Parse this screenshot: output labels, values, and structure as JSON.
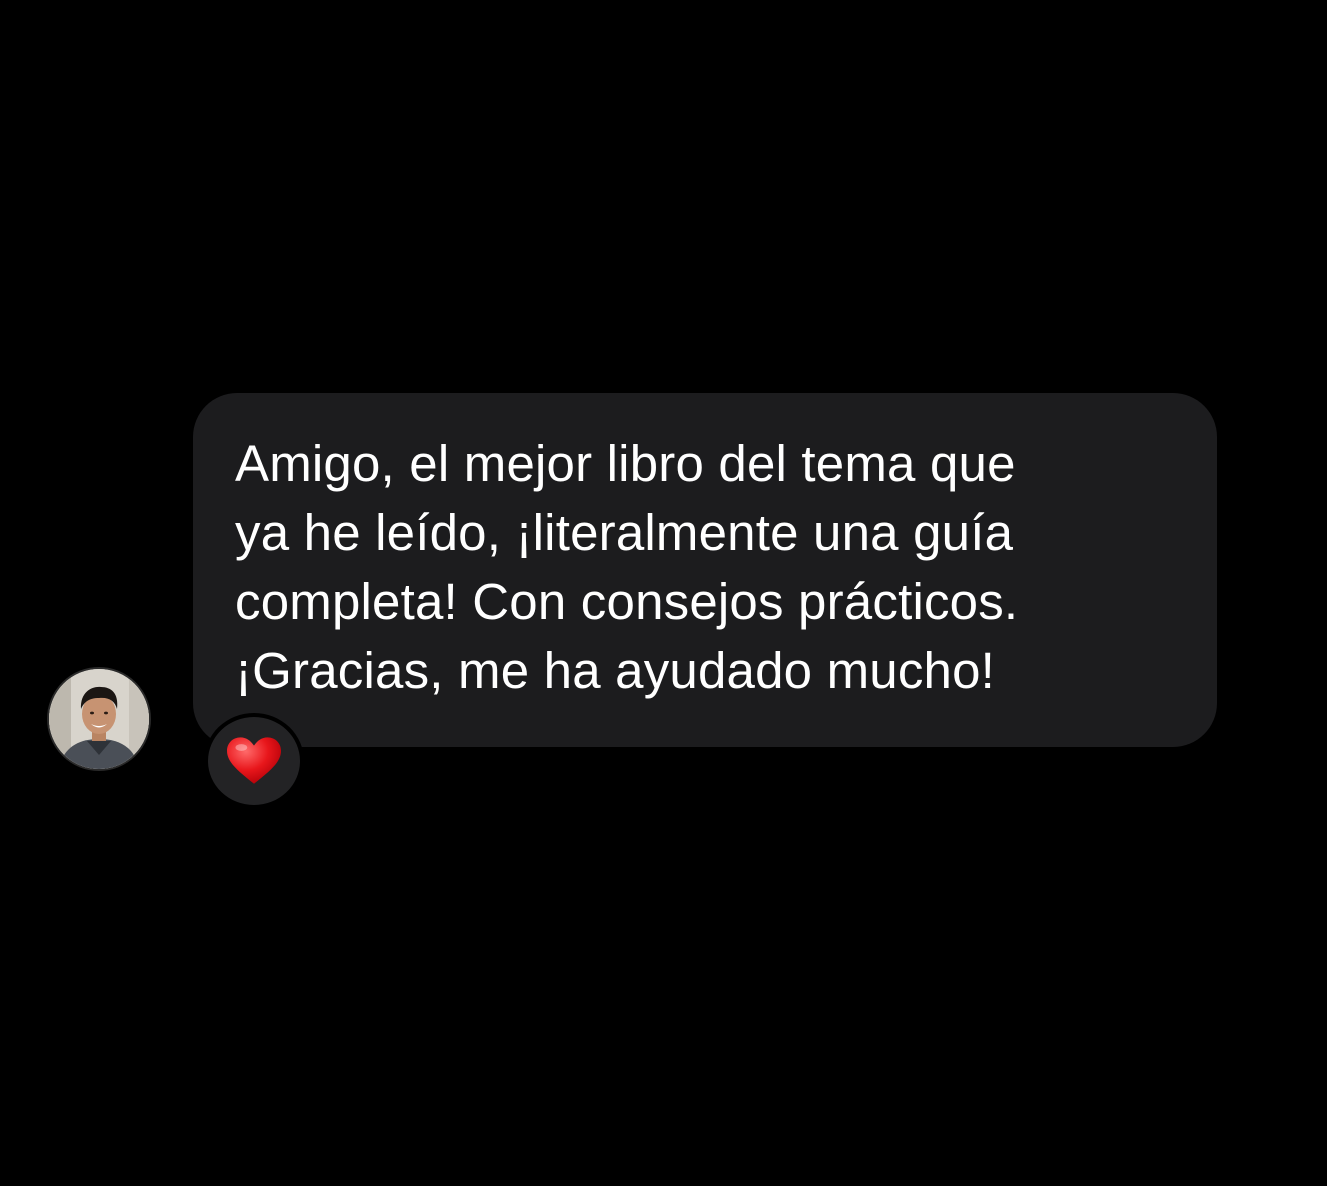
{
  "conversation": {
    "message": {
      "lines": [
        "Amigo, el mejor libro del tema que",
        "ya he leído, ¡literalmente una guía",
        "completa! Con consejos prácticos.",
        "¡Gracias, me ha ayudado mucho!"
      ],
      "bubble_color": "#1c1c1e",
      "text_color": "#ffffff"
    },
    "sender": {
      "avatar_icon": "user-avatar-photo"
    },
    "reaction": {
      "icon": "red-heart-icon",
      "color": "#e8161b"
    }
  },
  "page": {
    "background": "#000000"
  }
}
